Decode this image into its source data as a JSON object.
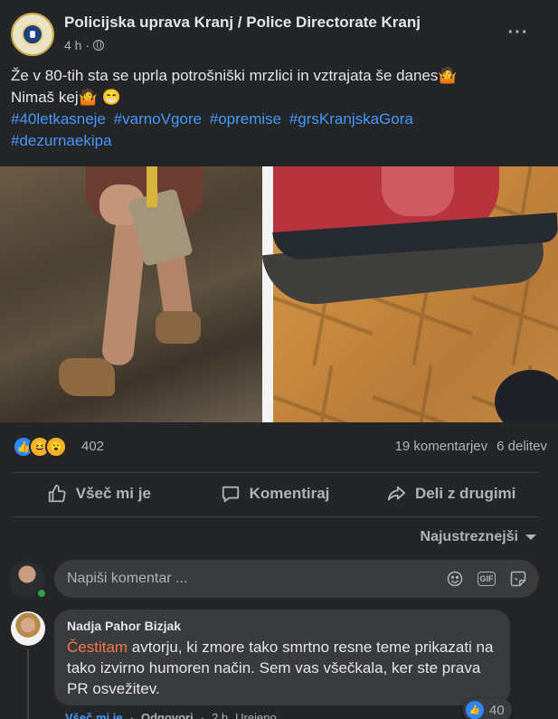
{
  "post": {
    "page_name": "Policijska uprava Kranj / Police Directorate Kranj",
    "time": "4 h",
    "separator": "·",
    "more_label": "···",
    "text_line1": "Že v 80-tih sta se uprla potrošniški mrzlici in vztrajata še danes🤷",
    "text_line2": "Nimaš kej🤷 😁",
    "hashtags": [
      "#40letkasneje",
      "#varnoVgore",
      "#opremise",
      "#grsKranjskaGora",
      "#dezurnaekipa"
    ]
  },
  "stats": {
    "reaction_count": "402",
    "comments": "19 komentarjev",
    "shares": "6 delitev",
    "reaction_icons": [
      "like-icon",
      "haha-icon",
      "wow-icon"
    ]
  },
  "actions": {
    "like": "Všeč mi je",
    "comment": "Komentiraj",
    "share": "Deli z drugimi"
  },
  "sort": {
    "label": "Najustreznejši"
  },
  "composer": {
    "placeholder": "Napiši komentar ..."
  },
  "comments": [
    {
      "author": "Nadja Pahor Bizjak",
      "highlight": "Čestitam",
      "text": " avtorju, ki zmore tako smrtno resne teme prikazati na tako izvirno humoren način. Sem vas všečkala, ker ste prava PR osvežitev.",
      "likes": "40",
      "like_label": "Všeč mi je",
      "reply_label": "Odgovori",
      "time": "2 h",
      "edited": "Urejeno"
    }
  ],
  "colors": {
    "background": "#242526",
    "link": "#4599ff",
    "highlight": "#f7764a",
    "like_blue": "#2d88ff"
  }
}
